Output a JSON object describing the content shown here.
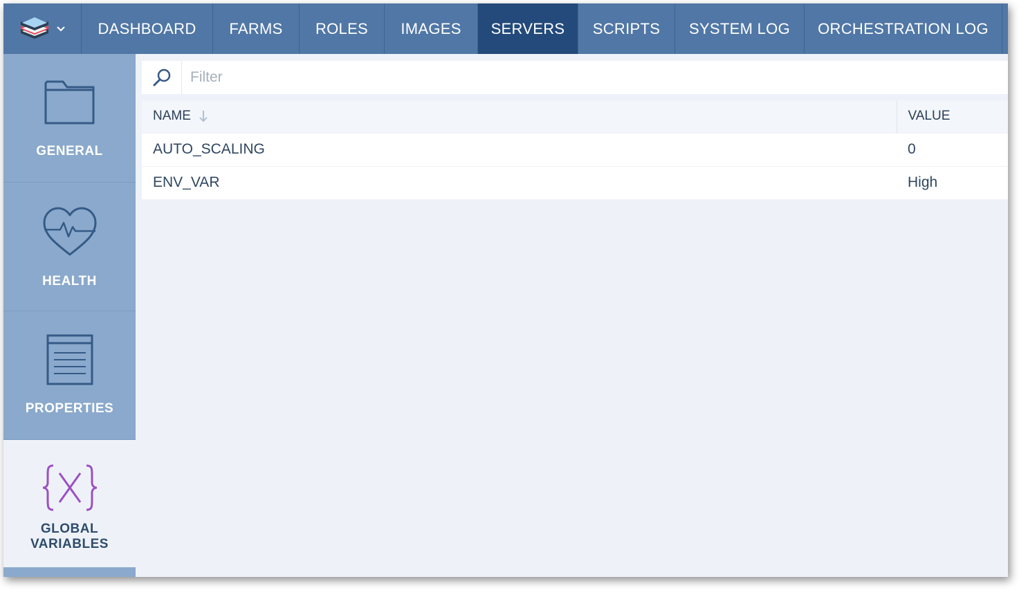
{
  "nav": {
    "logo_icon": "stack-logo-icon",
    "items": [
      {
        "label": "DASHBOARD"
      },
      {
        "label": "FARMS"
      },
      {
        "label": "ROLES"
      },
      {
        "label": "IMAGES"
      },
      {
        "label": "SERVERS",
        "active": true
      },
      {
        "label": "SCRIPTS"
      },
      {
        "label": "SYSTEM LOG"
      },
      {
        "label": "ORCHESTRATION LOG"
      }
    ]
  },
  "sidebar": {
    "items": [
      {
        "label": "GENERAL",
        "icon": "folder-icon"
      },
      {
        "label": "HEALTH",
        "icon": "heart-pulse-icon"
      },
      {
        "label": "PROPERTIES",
        "icon": "document-icon"
      },
      {
        "label_line1": "GLOBAL",
        "label_line2": "VARIABLES",
        "icon": "braces-x-icon",
        "active": true
      }
    ]
  },
  "filter": {
    "placeholder": "Filter"
  },
  "table": {
    "columns": [
      "NAME",
      "VALUE"
    ],
    "rows": [
      {
        "name": "AUTO_SCALING",
        "value": "0"
      },
      {
        "name": "ENV_VAR",
        "value": "High"
      }
    ]
  },
  "colors": {
    "nav_bg": "#5077a5",
    "nav_active": "#234a7a",
    "sidebar_bg": "#8aa9cc",
    "content_bg": "#eef2f8",
    "global_vars_icon": "#9b4fc4"
  }
}
